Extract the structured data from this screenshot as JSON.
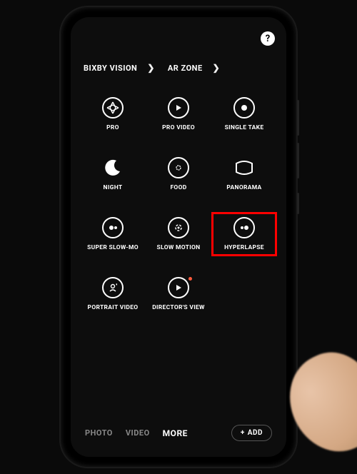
{
  "header": {
    "help_label": "?"
  },
  "top_row": {
    "bixby": "BIXBY VISION",
    "arzone": "AR ZONE"
  },
  "modes": [
    {
      "id": "pro",
      "label": "PRO",
      "icon": "aperture"
    },
    {
      "id": "pro-video",
      "label": "PRO VIDEO",
      "icon": "play"
    },
    {
      "id": "single-take",
      "label": "SINGLE TAKE",
      "icon": "dot"
    },
    {
      "id": "night",
      "label": "NIGHT",
      "icon": "moon"
    },
    {
      "id": "food",
      "label": "FOOD",
      "icon": "food"
    },
    {
      "id": "panorama",
      "label": "PANORAMA",
      "icon": "pano"
    },
    {
      "id": "super-slow-mo",
      "label": "SUPER SLOW-MO",
      "icon": "sslow"
    },
    {
      "id": "slow-motion",
      "label": "SLOW MOTION",
      "icon": "slow"
    },
    {
      "id": "hyperlapse",
      "label": "HYPERLAPSE",
      "icon": "hyper",
      "highlight": true
    },
    {
      "id": "portrait-video",
      "label": "PORTRAIT VIDEO",
      "icon": "portrait"
    },
    {
      "id": "directors-view",
      "label": "DIRECTOR'S VIEW",
      "icon": "director",
      "dot": true
    }
  ],
  "bottom": {
    "photo": "PHOTO",
    "video": "VIDEO",
    "more": "MORE",
    "add": "ADD"
  }
}
